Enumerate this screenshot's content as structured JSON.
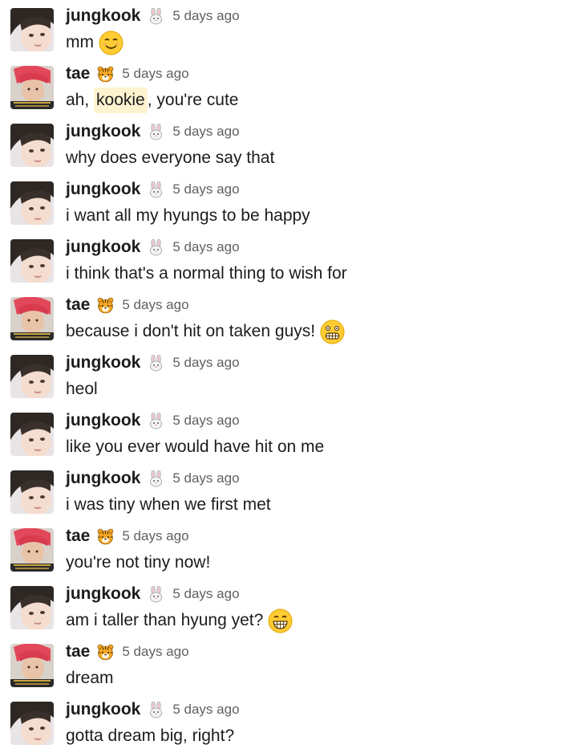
{
  "users": {
    "jungkook": {
      "name": "jungkook",
      "badge_icon": "rabbit-face-icon"
    },
    "tae": {
      "name": "tae",
      "badge_icon": "tiger-face-icon"
    }
  },
  "messages": [
    {
      "user": "jungkook",
      "time": "5 days ago",
      "text": "mm",
      "emoji": "smiling-face-icon"
    },
    {
      "user": "tae",
      "time": "5 days ago",
      "text_before": "ah, ",
      "mention": "kookie",
      "text_after": ", you're cute"
    },
    {
      "user": "jungkook",
      "time": "5 days ago",
      "text": "why does everyone say that"
    },
    {
      "user": "jungkook",
      "time": "5 days ago",
      "text": "i want all my hyungs to be happy"
    },
    {
      "user": "jungkook",
      "time": "5 days ago",
      "text": "i think that's a normal thing to wish for"
    },
    {
      "user": "tae",
      "time": "5 days ago",
      "text": "because i don't hit on taken guys!",
      "emoji": "grimacing-face-icon"
    },
    {
      "user": "jungkook",
      "time": "5 days ago",
      "text": "heol"
    },
    {
      "user": "jungkook",
      "time": "5 days ago",
      "text": "like you ever would have hit on me"
    },
    {
      "user": "jungkook",
      "time": "5 days ago",
      "text": "i was tiny when we first met"
    },
    {
      "user": "tae",
      "time": "5 days ago",
      "text": "you're not tiny now!"
    },
    {
      "user": "jungkook",
      "time": "5 days ago",
      "text": "am i taller than hyung yet?",
      "emoji": "grinning-face-icon"
    },
    {
      "user": "tae",
      "time": "5 days ago",
      "text": "dream"
    },
    {
      "user": "jungkook",
      "time": "5 days ago",
      "text": "gotta dream big, right?"
    }
  ]
}
